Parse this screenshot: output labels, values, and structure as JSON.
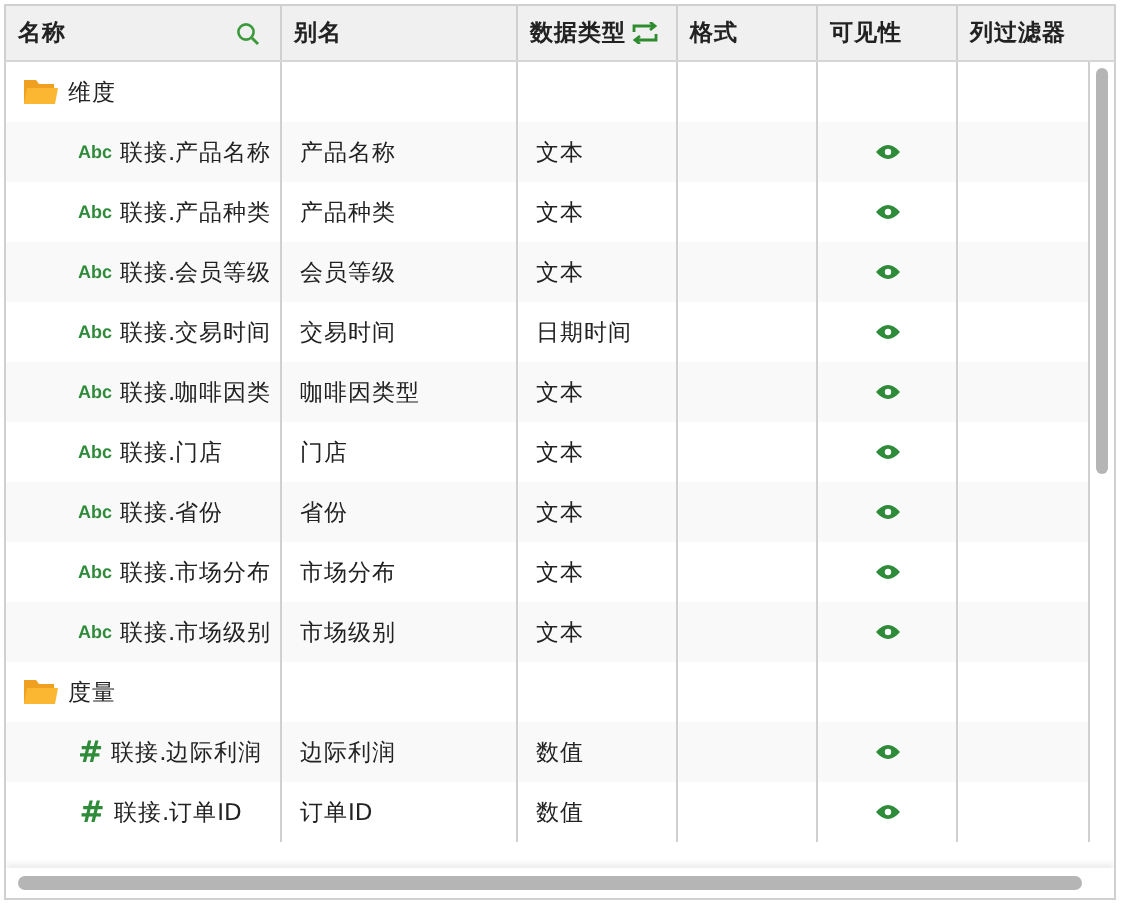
{
  "columns": [
    {
      "label": "名称",
      "searchable": true
    },
    {
      "label": "别名"
    },
    {
      "label": "数据类型",
      "convertible": true
    },
    {
      "label": "格式"
    },
    {
      "label": "可见性"
    },
    {
      "label": "列过滤器"
    }
  ],
  "groups": [
    {
      "label": "维度",
      "items": [
        {
          "kind": "text",
          "icon": "Abc",
          "name": "联接.产品名称",
          "alias": "产品名称",
          "data_type": "文本",
          "visible": true
        },
        {
          "kind": "text",
          "icon": "Abc",
          "name": "联接.产品种类",
          "alias": "产品种类",
          "data_type": "文本",
          "visible": true
        },
        {
          "kind": "text",
          "icon": "Abc",
          "name": "联接.会员等级",
          "alias": "会员等级",
          "data_type": "文本",
          "visible": true
        },
        {
          "kind": "text",
          "icon": "Abc",
          "name": "联接.交易时间",
          "alias": "交易时间",
          "data_type": "日期时间",
          "visible": true
        },
        {
          "kind": "text",
          "icon": "Abc",
          "name": "联接.咖啡因类",
          "alias": "咖啡因类型",
          "data_type": "文本",
          "visible": true
        },
        {
          "kind": "text",
          "icon": "Abc",
          "name": "联接.门店",
          "alias": "门店",
          "data_type": "文本",
          "visible": true
        },
        {
          "kind": "text",
          "icon": "Abc",
          "name": "联接.省份",
          "alias": "省份",
          "data_type": "文本",
          "visible": true
        },
        {
          "kind": "text",
          "icon": "Abc",
          "name": "联接.市场分布",
          "alias": "市场分布",
          "data_type": "文本",
          "visible": true
        },
        {
          "kind": "text",
          "icon": "Abc",
          "name": "联接.市场级别",
          "alias": "市场级别",
          "data_type": "文本",
          "visible": true
        }
      ]
    },
    {
      "label": "度量",
      "items": [
        {
          "kind": "number",
          "icon": "#",
          "name": "联接.边际利润",
          "alias": "边际利润",
          "data_type": "数值",
          "visible": true
        },
        {
          "kind": "number",
          "icon": "#",
          "name": "联接.订单ID",
          "alias": "订单ID",
          "data_type": "数值",
          "visible": true
        }
      ]
    }
  ]
}
